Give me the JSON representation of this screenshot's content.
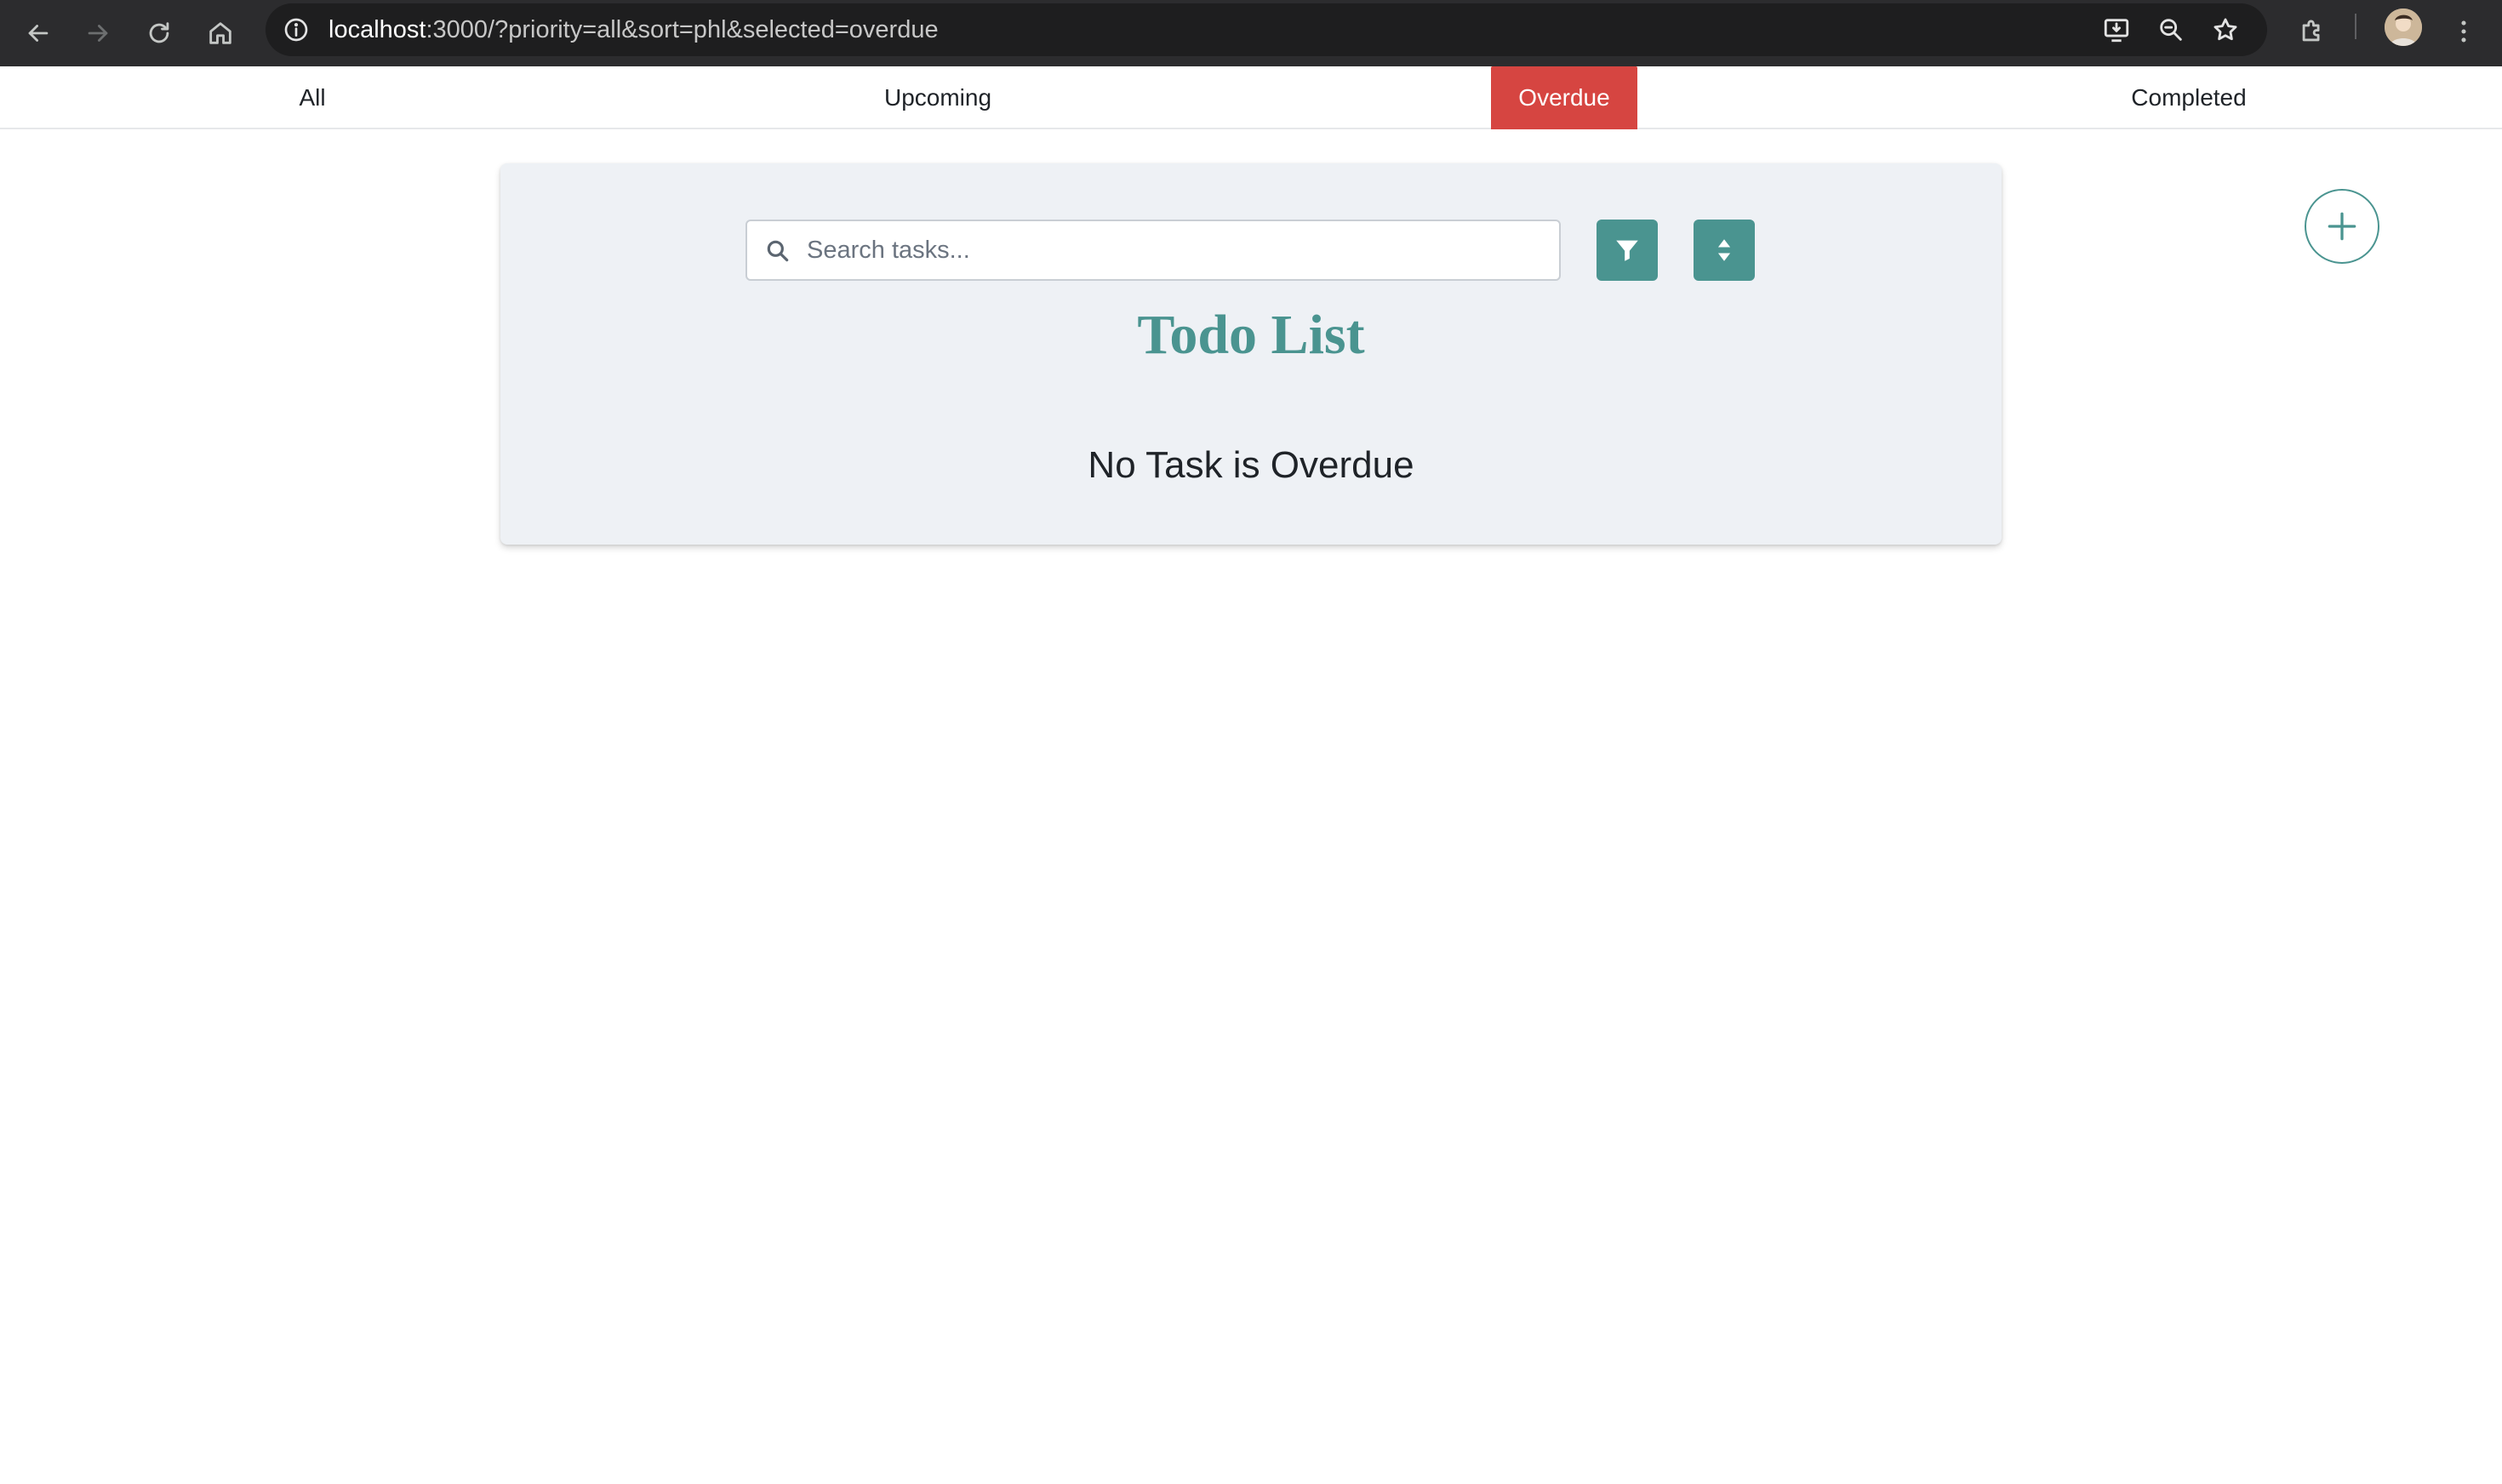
{
  "browser": {
    "url_host": "localhost",
    "url_rest": ":3000/?priority=all&sort=phl&selected=overdue",
    "icons": {
      "back": "arrow-left-icon",
      "forward": "arrow-right-icon",
      "reload": "reload-icon",
      "home": "home-icon",
      "site_info": "info-icon",
      "install": "install-app-icon",
      "zoom": "zoom-out-icon",
      "bookmark": "star-icon",
      "extensions": "puzzle-icon",
      "menu": "kebab-menu-icon"
    }
  },
  "tabs": [
    {
      "label": "All",
      "active": false
    },
    {
      "label": "Upcoming",
      "active": false
    },
    {
      "label": "Overdue",
      "active": true
    },
    {
      "label": "Completed",
      "active": false
    }
  ],
  "search": {
    "value": "",
    "placeholder": "Search tasks..."
  },
  "toolbar": {
    "filter_icon": "filter-icon",
    "sort_icon": "sort-icon",
    "add_icon": "plus-icon"
  },
  "main": {
    "title": "Todo List",
    "empty_message": "No Task is Overdue"
  },
  "colors": {
    "chrome_bg": "#2c2c2e",
    "accent_teal": "#4a9490",
    "active_tab_red": "#d64541",
    "card_bg": "#eef1f5"
  }
}
